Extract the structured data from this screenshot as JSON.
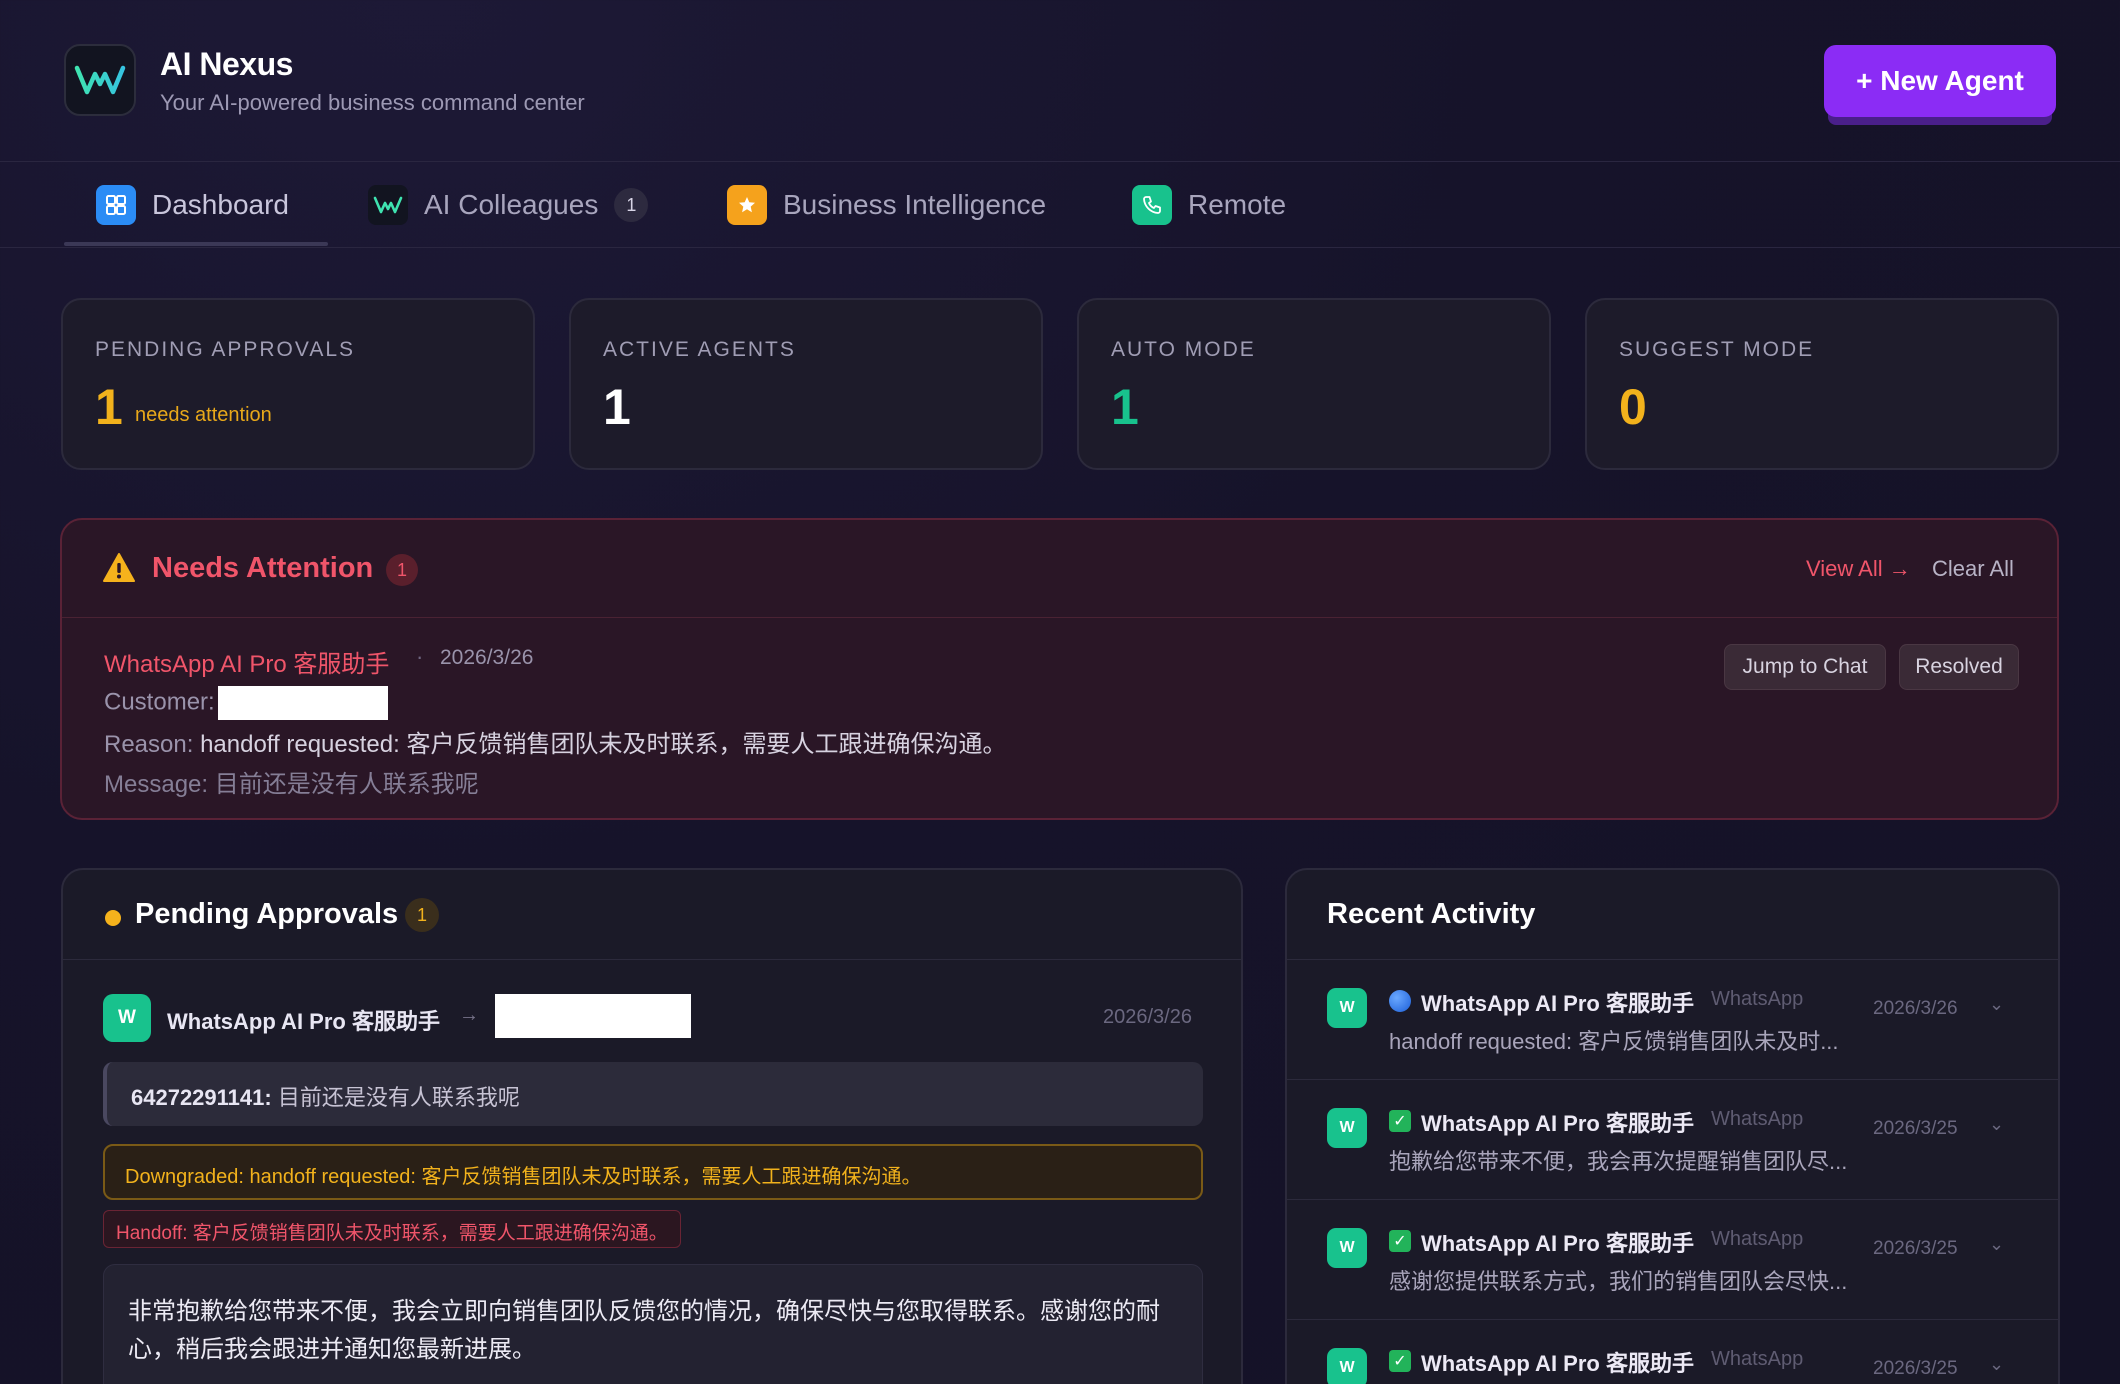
{
  "app": {
    "title": "AI Nexus",
    "subtitle": "Your AI-powered business command center",
    "new_agent_label": "+ New Agent",
    "logo_icon": "wave-logo-icon"
  },
  "tabs": [
    {
      "label": "Dashboard",
      "icon": "grid-icon",
      "active": true
    },
    {
      "label": "AI Colleagues",
      "icon": "wave-icon",
      "badge": "1"
    },
    {
      "label": "Business Intelligence",
      "icon": "star-icon"
    },
    {
      "label": "Remote",
      "icon": "phone-icon"
    }
  ],
  "stats": [
    {
      "label": "PENDING APPROVALS",
      "value": "1",
      "note": "needs attention",
      "color": "#f2b21c"
    },
    {
      "label": "ACTIVE AGENTS",
      "value": "1",
      "color": "#ffffff"
    },
    {
      "label": "AUTO MODE",
      "value": "1",
      "color": "#18c28d"
    },
    {
      "label": "SUGGEST MODE",
      "value": "0",
      "color": "#f2b21c"
    }
  ],
  "attention": {
    "title": "Needs Attention",
    "count": "1",
    "view_all": "View All →",
    "clear_all": "Clear All",
    "item": {
      "agent": "WhatsApp AI Pro 客服助手",
      "dot": "·",
      "date": "2026/3/26",
      "customer_label": "Customer:",
      "reason_label": "Reason:",
      "reason": "handoff requested: 客户反馈销售团队未及时联系，需要人工跟进确保沟通。",
      "message_label": "Message:",
      "message": "目前还是没有人联系我呢",
      "jump_label": "Jump to Chat",
      "resolved_label": "Resolved"
    }
  },
  "pending": {
    "title": "Pending Approvals",
    "count": "1",
    "item": {
      "avatar": "W",
      "agent": "WhatsApp AI Pro 客服助手",
      "arrow": "→",
      "date": "2026/3/26",
      "sender": "64272291141:",
      "message": "目前还是没有人联系我呢",
      "downgraded": "Downgraded: handoff requested: 客户反馈销售团队未及时联系，需要人工跟进确保沟通。",
      "handoff": "Handoff: 客户反馈销售团队未及时联系，需要人工跟进确保沟通。",
      "reply": "非常抱歉给您带来不便，我会立即向销售团队反馈您的情况，确保尽快与您取得联系。感谢您的耐心，稍后我会跟进并通知您最新进展。"
    }
  },
  "activity": {
    "title": "Recent Activity",
    "items": [
      {
        "avatar": "W",
        "status": "blue-circle",
        "agent": "WhatsApp AI Pro 客服助手",
        "channel": "WhatsApp",
        "date": "2026/3/26",
        "text": "handoff requested: 客户反馈销售团队未及时...",
        "chevron": "⌄"
      },
      {
        "avatar": "W",
        "status": "green-check",
        "agent": "WhatsApp AI Pro 客服助手",
        "channel": "WhatsApp",
        "date": "2026/3/25",
        "text": "抱歉给您带来不便，我会再次提醒销售团队尽...",
        "chevron": "⌄"
      },
      {
        "avatar": "W",
        "status": "green-check",
        "agent": "WhatsApp AI Pro 客服助手",
        "channel": "WhatsApp",
        "date": "2026/3/25",
        "text": "感谢您提供联系方式，我们的销售团队会尽快...",
        "chevron": "⌄"
      },
      {
        "avatar": "W",
        "status": "green-check",
        "agent": "WhatsApp AI Pro 客服助手",
        "channel": "WhatsApp",
        "date": "2026/3/25",
        "text": "",
        "chevron": "⌄"
      }
    ]
  }
}
